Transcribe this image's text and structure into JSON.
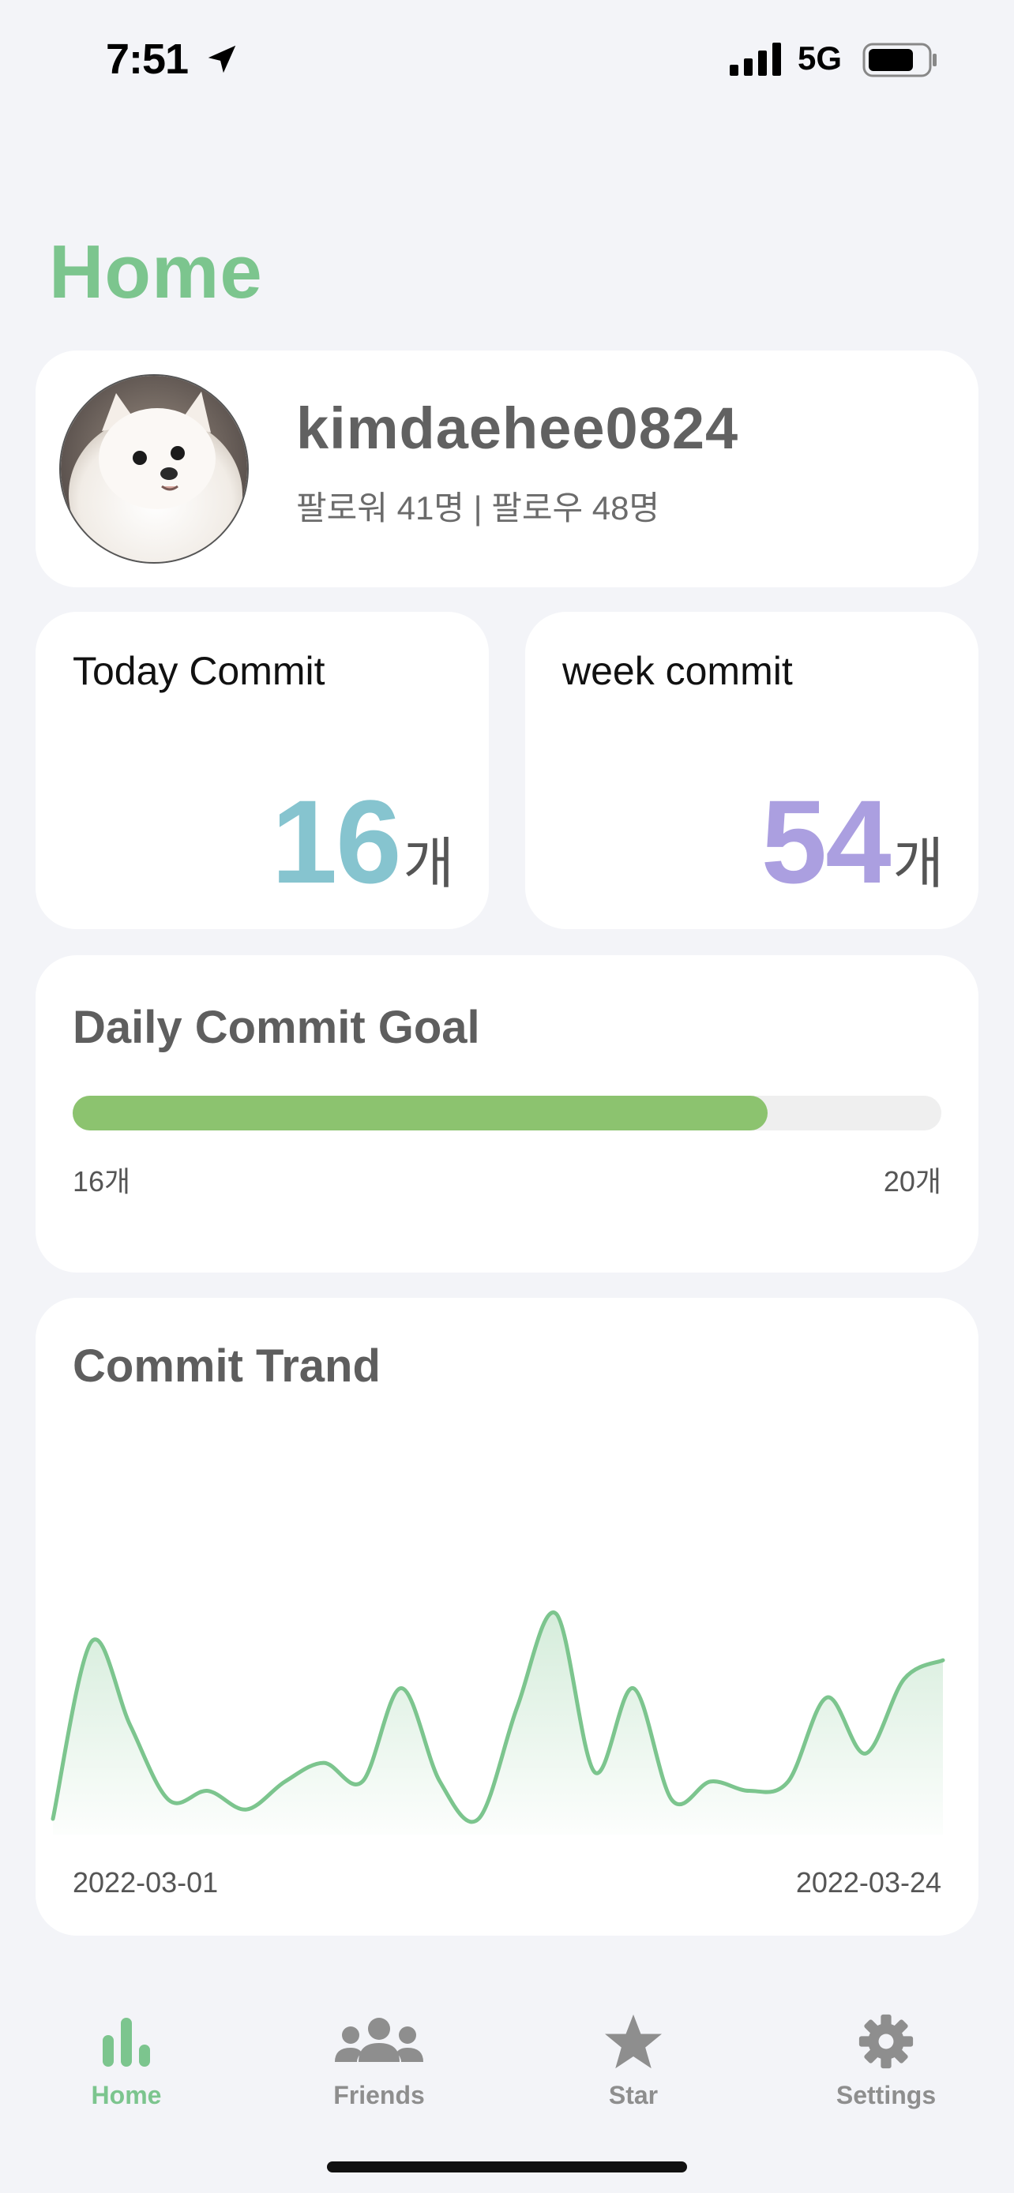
{
  "status_bar": {
    "time": "7:51",
    "network": "5G"
  },
  "page": {
    "title": "Home"
  },
  "profile": {
    "username": "kimdaehee0824",
    "followers_text": "팔로워 41명 | 팔로우 48명"
  },
  "stats": {
    "today": {
      "label": "Today Commit",
      "value": "16",
      "unit": "개",
      "color": "#86c4cf"
    },
    "week": {
      "label": "week commit",
      "value": "54",
      "unit": "개",
      "color": "#ab9fe0"
    }
  },
  "goal": {
    "title": "Daily Commit Goal",
    "current_label": "16개",
    "target_label": "20개",
    "current": 16,
    "target": 20,
    "progress_fraction": 0.8,
    "color": "#8cc36f"
  },
  "trend": {
    "title": "Commit Trand",
    "start_date": "2022-03-01",
    "end_date": "2022-03-24",
    "line_color": "#7cc58e"
  },
  "chart_data": {
    "type": "area",
    "title": "Commit Trand",
    "x": [
      "2022-03-01",
      "2022-03-02",
      "2022-03-03",
      "2022-03-04",
      "2022-03-05",
      "2022-03-06",
      "2022-03-07",
      "2022-03-08",
      "2022-03-09",
      "2022-03-10",
      "2022-03-11",
      "2022-03-12",
      "2022-03-13",
      "2022-03-14",
      "2022-03-15",
      "2022-03-16",
      "2022-03-17",
      "2022-03-18",
      "2022-03-19",
      "2022-03-20",
      "2022-03-21",
      "2022-03-22",
      "2022-03-23",
      "2022-03-24"
    ],
    "values": [
      0,
      19,
      10,
      2,
      3,
      1,
      4,
      6,
      4,
      14,
      4,
      0,
      12,
      22,
      5,
      14,
      2,
      4,
      3,
      4,
      13,
      7,
      15,
      17
    ],
    "xlabel": "",
    "ylabel": "",
    "grid": false,
    "legend": "none"
  },
  "tabs": [
    {
      "label": "Home",
      "icon": "chart-bar-icon",
      "active": true
    },
    {
      "label": "Friends",
      "icon": "people-icon",
      "active": false
    },
    {
      "label": "Star",
      "icon": "star-icon",
      "active": false
    },
    {
      "label": "Settings",
      "icon": "gear-icon",
      "active": false
    }
  ],
  "colors": {
    "accent": "#7cc58e",
    "background": "#f3f4f8",
    "inactive": "#8e8e8e"
  }
}
